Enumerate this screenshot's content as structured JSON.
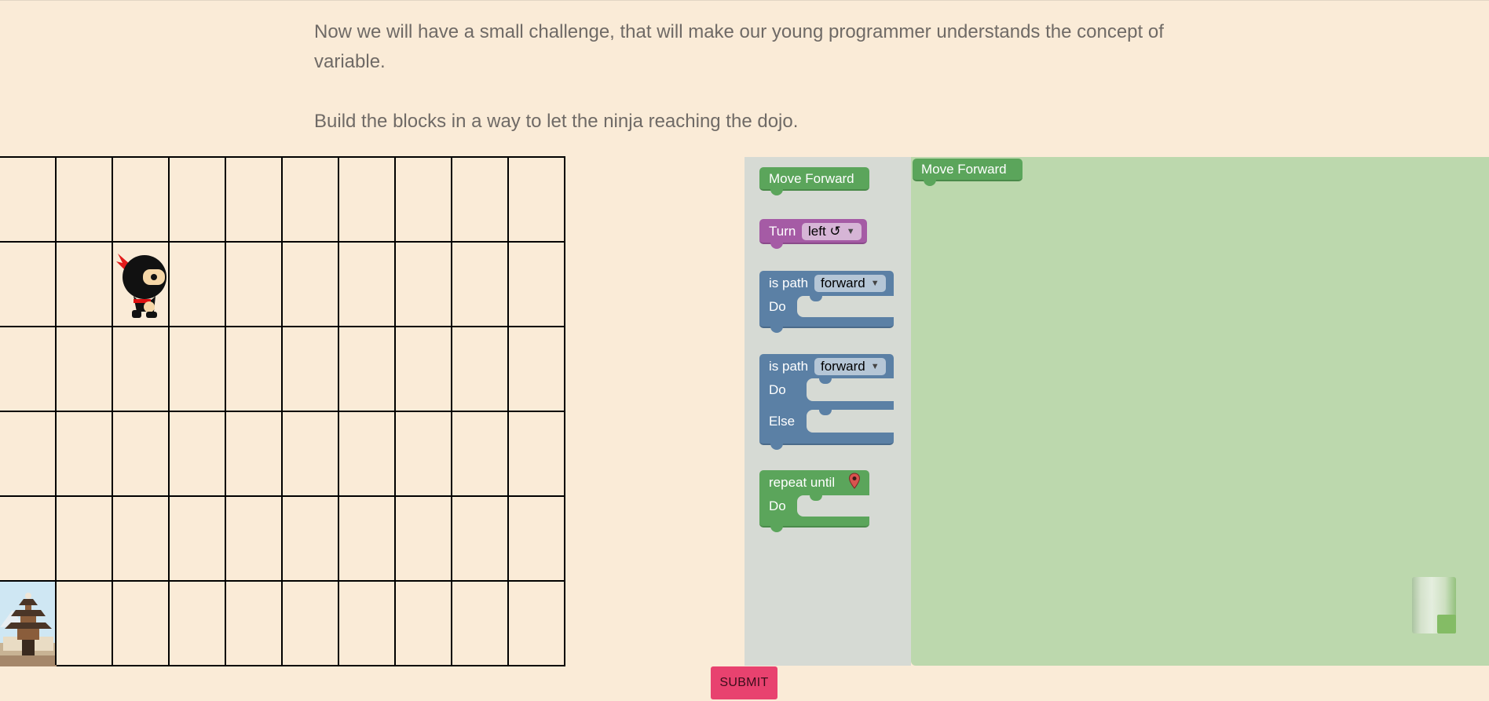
{
  "intro": {
    "line1": "Now we will have a small challenge, that will make our young programmer understands the concept of variable.",
    "line2": "Build the blocks in a way to let the ninja reaching the dojo."
  },
  "maze": {
    "rows": 6,
    "cols": 10,
    "ninja_position": {
      "row": 2,
      "col": 3
    },
    "dojo_position": {
      "row": 6,
      "col": 1
    }
  },
  "toolbox": {
    "move_forward": "Move Forward",
    "turn": {
      "label": "Turn",
      "dropdown": "left ↺"
    },
    "if_path": {
      "label": "is path",
      "dropdown": "forward",
      "do": "Do"
    },
    "if_else_path": {
      "label": "is path",
      "dropdown": "forward",
      "do": "Do",
      "else": "Else"
    },
    "repeat_until": {
      "label": "repeat until",
      "do": "Do"
    }
  },
  "workspace": {
    "placed_block": "Move Forward"
  },
  "colors": {
    "background": "#faebd7",
    "motion_block": "#5ba55b",
    "turn_block": "#a55ba5",
    "logic_block": "#5b80a5",
    "submit": "#e8426f"
  },
  "submit_label": "SUBMIT"
}
